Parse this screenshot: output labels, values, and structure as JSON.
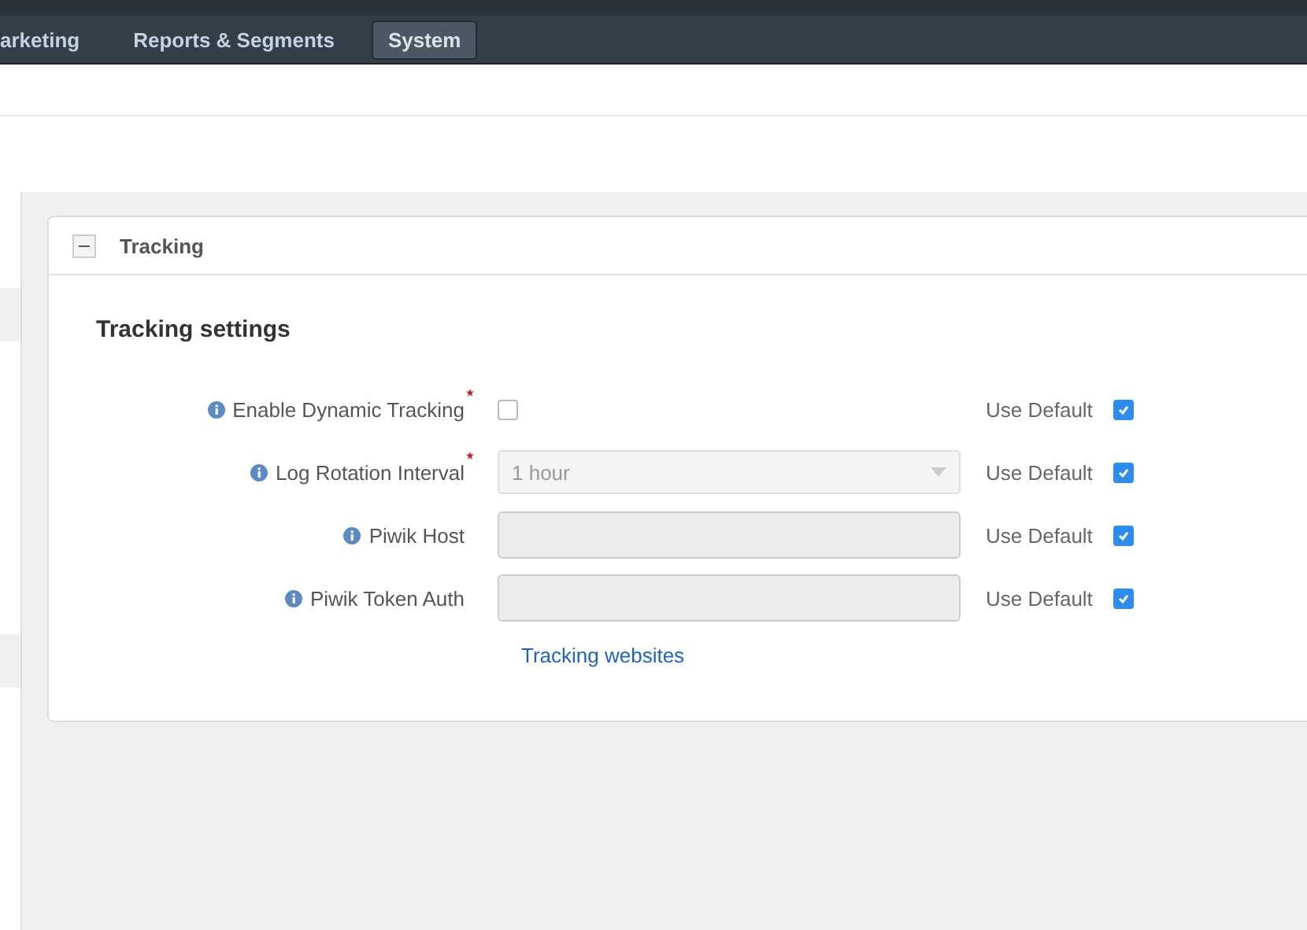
{
  "nav": [
    {
      "label": "arketing",
      "selected": false
    },
    {
      "label": "Reports & Segments",
      "selected": false
    },
    {
      "label": "System",
      "selected": true
    }
  ],
  "panel": {
    "title": "Tracking",
    "expanded": true,
    "section_title": "Tracking settings",
    "fields": [
      {
        "kind": "checkbox",
        "label": "Enable Dynamic Tracking",
        "required": true,
        "checked": false,
        "use_default": true,
        "default_label": "Use Default"
      },
      {
        "kind": "select",
        "label": "Log Rotation Interval",
        "required": true,
        "value": "1 hour",
        "disabled": true,
        "use_default": true,
        "default_label": "Use Default"
      },
      {
        "kind": "text",
        "label": "Piwik Host",
        "required": false,
        "disabled": true,
        "use_default": true,
        "default_label": "Use Default"
      },
      {
        "kind": "text",
        "label": "Piwik Token Auth",
        "required": false,
        "disabled": true,
        "use_default": true,
        "default_label": "Use Default"
      }
    ],
    "link": "Tracking websites"
  }
}
